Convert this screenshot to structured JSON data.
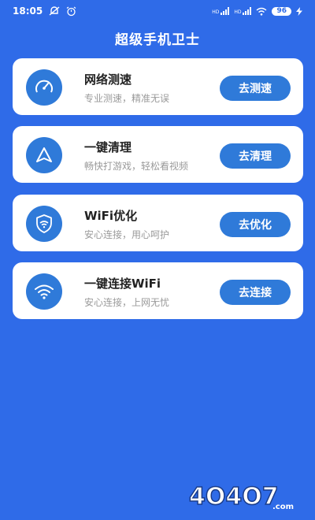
{
  "status_bar": {
    "time": "18:05",
    "signal1_label": "HD",
    "signal2_label": "HD",
    "battery": "96",
    "icons": [
      "mute-icon",
      "alarm-icon",
      "signal-icon",
      "wifi-icon",
      "battery-icon",
      "charging-icon"
    ]
  },
  "header": {
    "title": "超级手机卫士"
  },
  "cards": [
    {
      "icon": "speedometer-icon",
      "title": "网络测速",
      "subtitle": "专业测速，精准无误",
      "button": "去测速"
    },
    {
      "icon": "triangle-icon",
      "title": "一键清理",
      "subtitle": "畅快打游戏，轻松看视频",
      "button": "去清理"
    },
    {
      "icon": "shield-wifi-icon",
      "title": "WiFi优化",
      "subtitle": "安心连接，用心呵护",
      "button": "去优化"
    },
    {
      "icon": "wifi-icon",
      "title": "一键连接WiFi",
      "subtitle": "安心连接，上网无忧",
      "button": "去连接"
    }
  ],
  "watermark": {
    "text": "4O4O7.com"
  },
  "colors": {
    "background": "#2f6be8",
    "accent": "#2f7ad9",
    "card": "#ffffff"
  }
}
